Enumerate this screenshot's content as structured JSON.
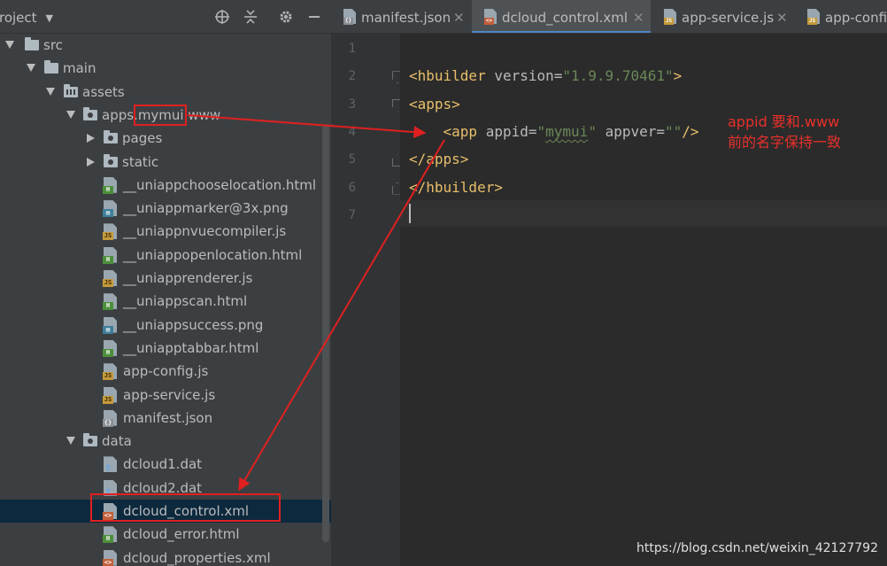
{
  "project_panel": {
    "title": "roject",
    "toolbar_icons": [
      "locate-icon",
      "collapse-all-icon",
      "gear-icon",
      "minimize-icon"
    ],
    "tree": [
      {
        "label": "src",
        "type": "folder",
        "expanded": true,
        "depth": 0
      },
      {
        "label": "main",
        "type": "folder",
        "expanded": true,
        "depth": 1
      },
      {
        "label": "assets",
        "type": "res-folder",
        "expanded": true,
        "depth": 2
      },
      {
        "label": "apps.mymui.www",
        "type": "pkg-folder",
        "expanded": true,
        "depth": 3
      },
      {
        "label": "pages",
        "type": "pkg-folder",
        "expanded": false,
        "depth": 4
      },
      {
        "label": "static",
        "type": "pkg-folder",
        "expanded": false,
        "depth": 4
      },
      {
        "label": "__uniappchooselocation.html",
        "type": "html",
        "depth": 4
      },
      {
        "label": "__uniappmarker@3x.png",
        "type": "img",
        "depth": 4
      },
      {
        "label": "__uniappnvuecompiler.js",
        "type": "js",
        "depth": 4
      },
      {
        "label": "__uniappopenlocation.html",
        "type": "html",
        "depth": 4
      },
      {
        "label": "__uniapprenderer.js",
        "type": "js",
        "depth": 4
      },
      {
        "label": "__uniappscan.html",
        "type": "html",
        "depth": 4
      },
      {
        "label": "__uniappsuccess.png",
        "type": "img",
        "depth": 4
      },
      {
        "label": "__uniapptabbar.html",
        "type": "html",
        "depth": 4
      },
      {
        "label": "app-config.js",
        "type": "js",
        "depth": 4
      },
      {
        "label": "app-service.js",
        "type": "js",
        "depth": 4
      },
      {
        "label": "manifest.json",
        "type": "json",
        "depth": 4
      },
      {
        "label": "data",
        "type": "pkg-folder",
        "expanded": true,
        "depth": 3
      },
      {
        "label": "dcloud1.dat",
        "type": "unknown",
        "depth": 4
      },
      {
        "label": "dcloud2.dat",
        "type": "unknown",
        "depth": 4
      },
      {
        "label": "dcloud_control.xml",
        "type": "xml",
        "depth": 4,
        "selected": true
      },
      {
        "label": "dcloud_error.html",
        "type": "html",
        "depth": 4
      },
      {
        "label": "dcloud_properties.xml",
        "type": "xml",
        "depth": 4
      }
    ]
  },
  "tabs": [
    {
      "label": "manifest.json",
      "type": "json",
      "active": false,
      "closable": true
    },
    {
      "label": "dcloud_control.xml",
      "type": "xml",
      "active": true,
      "closable": true
    },
    {
      "label": "app-service.js",
      "type": "js",
      "active": false,
      "closable": true
    },
    {
      "label": "app-confi",
      "type": "js",
      "active": false,
      "closable": false
    }
  ],
  "editor": {
    "line_numbers": [
      "1",
      "2",
      "3",
      "4",
      "5",
      "6",
      "7"
    ],
    "current_line": 7,
    "lines": [
      [],
      [
        {
          "t": "<hbuilder ",
          "c": "tag"
        },
        {
          "t": "version=",
          "c": "attr"
        },
        {
          "t": "\"1.9.9.70461\"",
          "c": "val"
        },
        {
          "t": ">",
          "c": "tag"
        }
      ],
      [
        {
          "t": "<apps>",
          "c": "tag"
        }
      ],
      [
        {
          "t": "    <app ",
          "c": "tag"
        },
        {
          "t": "appid=",
          "c": "attr"
        },
        {
          "t": "\"",
          "c": "val"
        },
        {
          "t": "mymui",
          "c": "val squiggle"
        },
        {
          "t": "\" ",
          "c": "val"
        },
        {
          "t": "appver=",
          "c": "attr"
        },
        {
          "t": "\"\"",
          "c": "val"
        },
        {
          "t": "/>",
          "c": "tag"
        }
      ],
      [
        {
          "t": "</apps>",
          "c": "tag"
        }
      ],
      [
        {
          "t": "</hbuilder>",
          "c": "tag"
        }
      ],
      []
    ]
  },
  "annotation": {
    "line1": "appid 要和.www",
    "line2": "前的名字保持一致"
  },
  "colors": {
    "annotation_red": "#e02020",
    "selection_bg": "#0d293e",
    "tab_active_underline": "#4a88c7"
  },
  "watermark": "https://blog.csdn.net/weixin_42127792"
}
